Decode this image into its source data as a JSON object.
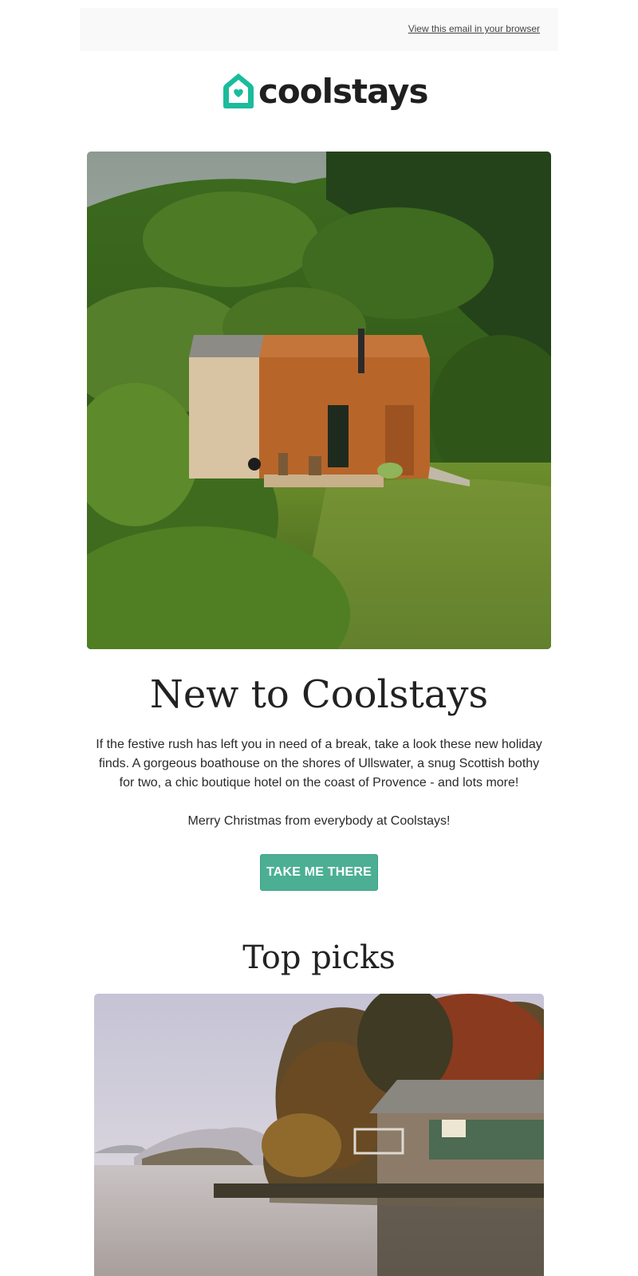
{
  "preheader": {
    "view_in_browser": "View this email in your browser"
  },
  "brand": {
    "name": "coolstays",
    "accent": "#1abc9c"
  },
  "hero": {
    "image_alt": "Timber and corrugated metal cabin in a green hillside meadow"
  },
  "intro": {
    "headline": "New to Coolstays",
    "body": "If the festive rush has left you in need of a break, take a look these new holiday finds. A gorgeous boathouse on the shores of Ullswater, a snug Scottish bothy for two, a chic boutique hotel on the coast of Provence - and lots more!",
    "signoff": "Merry Christmas from everybody at Coolstays!",
    "cta_label": "TAKE ME THERE",
    "cta_color": "#4caf94"
  },
  "top_picks": {
    "title": "Top picks",
    "first_image_alt": "Stone boathouse on a misty lake in autumn"
  }
}
